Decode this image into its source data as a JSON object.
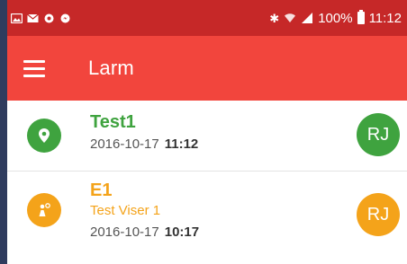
{
  "status_bar": {
    "left_icons": [
      "gallery-icon",
      "email-icon",
      "record-icon",
      "messenger-icon"
    ],
    "right_icons": [
      "bluetooth-icon",
      "wifi-icon",
      "signal-icon"
    ],
    "battery": "100%",
    "time": "11:12"
  },
  "app_bar": {
    "title": "Larm",
    "menu_icon": "hamburger-menu-icon",
    "color": "#f2453d"
  },
  "alarms": [
    {
      "icon": "location-pin-icon",
      "color": "#3fa33f",
      "title": "Test1",
      "date": "2016-10-17",
      "time": "11:12",
      "avatar": "RJ"
    },
    {
      "icon": "person-alert-icon",
      "color": "#f4a31a",
      "title": "E1",
      "subtitle": "Test Viser 1",
      "date": "2016-10-17",
      "time": "10:17",
      "avatar": "RJ"
    }
  ]
}
